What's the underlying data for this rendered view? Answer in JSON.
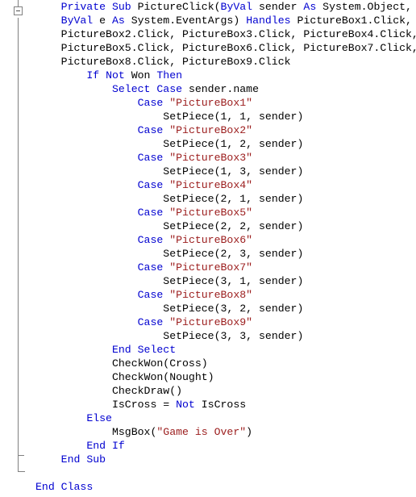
{
  "editor": {
    "language": "VB.NET",
    "colors": {
      "background": "#ffffff",
      "keyword": "#0000D0",
      "string": "#9B1C1C",
      "identifier": "#000000",
      "gutter_line": "#808080"
    },
    "gutter": {
      "fold_box_icon": "minus-icon",
      "fold_box_state": "expanded"
    }
  },
  "code": {
    "lines": [
      {
        "indent": 4,
        "continuation": true,
        "tokens": [
          {
            "t": "Private",
            "c": "kw"
          },
          {
            "t": " ",
            "c": "id"
          },
          {
            "t": "Sub",
            "c": "kw"
          },
          {
            "t": " PictureClick(",
            "c": "id"
          },
          {
            "t": "ByVal",
            "c": "kw"
          },
          {
            "t": " sender ",
            "c": "id"
          },
          {
            "t": "As",
            "c": "kw"
          },
          {
            "t": " System.Object, ",
            "c": "id"
          }
        ]
      },
      {
        "indent": 4,
        "continuation": true,
        "tokens": [
          {
            "t": "ByVal",
            "c": "kw"
          },
          {
            "t": " e ",
            "c": "id"
          },
          {
            "t": "As",
            "c": "kw"
          },
          {
            "t": " System.EventArgs) ",
            "c": "id"
          },
          {
            "t": "Handles",
            "c": "kw"
          },
          {
            "t": " PictureBox1.Click, ",
            "c": "id"
          }
        ]
      },
      {
        "indent": 4,
        "continuation": true,
        "tokens": [
          {
            "t": "PictureBox2.Click, PictureBox3.Click, PictureBox4.Click, ",
            "c": "id"
          }
        ]
      },
      {
        "indent": 4,
        "continuation": true,
        "tokens": [
          {
            "t": "PictureBox5.Click, PictureBox6.Click, PictureBox7.Click, ",
            "c": "id"
          }
        ]
      },
      {
        "indent": 4,
        "continuation": false,
        "tokens": [
          {
            "t": "PictureBox8.Click, PictureBox9.Click",
            "c": "id"
          }
        ]
      },
      {
        "indent": 8,
        "continuation": false,
        "tokens": [
          {
            "t": "If",
            "c": "kw"
          },
          {
            "t": " ",
            "c": "id"
          },
          {
            "t": "Not",
            "c": "kw"
          },
          {
            "t": " Won ",
            "c": "id"
          },
          {
            "t": "Then",
            "c": "kw"
          }
        ]
      },
      {
        "indent": 12,
        "continuation": false,
        "tokens": [
          {
            "t": "Select",
            "c": "kw"
          },
          {
            "t": " ",
            "c": "id"
          },
          {
            "t": "Case",
            "c": "kw"
          },
          {
            "t": " sender.name",
            "c": "id"
          }
        ]
      },
      {
        "indent": 16,
        "continuation": false,
        "tokens": [
          {
            "t": "Case",
            "c": "kw"
          },
          {
            "t": " ",
            "c": "id"
          },
          {
            "t": "\"PictureBox1\"",
            "c": "str"
          }
        ]
      },
      {
        "indent": 20,
        "continuation": false,
        "tokens": [
          {
            "t": "SetPiece(1, 1, sender)",
            "c": "id"
          }
        ]
      },
      {
        "indent": 16,
        "continuation": false,
        "tokens": [
          {
            "t": "Case",
            "c": "kw"
          },
          {
            "t": " ",
            "c": "id"
          },
          {
            "t": "\"PictureBox2\"",
            "c": "str"
          }
        ]
      },
      {
        "indent": 20,
        "continuation": false,
        "tokens": [
          {
            "t": "SetPiece(1, 2, sender)",
            "c": "id"
          }
        ]
      },
      {
        "indent": 16,
        "continuation": false,
        "tokens": [
          {
            "t": "Case",
            "c": "kw"
          },
          {
            "t": " ",
            "c": "id"
          },
          {
            "t": "\"PictureBox3\"",
            "c": "str"
          }
        ]
      },
      {
        "indent": 20,
        "continuation": false,
        "tokens": [
          {
            "t": "SetPiece(1, 3, sender)",
            "c": "id"
          }
        ]
      },
      {
        "indent": 16,
        "continuation": false,
        "tokens": [
          {
            "t": "Case",
            "c": "kw"
          },
          {
            "t": " ",
            "c": "id"
          },
          {
            "t": "\"PictureBox4\"",
            "c": "str"
          }
        ]
      },
      {
        "indent": 20,
        "continuation": false,
        "tokens": [
          {
            "t": "SetPiece(2, 1, sender)",
            "c": "id"
          }
        ]
      },
      {
        "indent": 16,
        "continuation": false,
        "tokens": [
          {
            "t": "Case",
            "c": "kw"
          },
          {
            "t": " ",
            "c": "id"
          },
          {
            "t": "\"PictureBox5\"",
            "c": "str"
          }
        ]
      },
      {
        "indent": 20,
        "continuation": false,
        "tokens": [
          {
            "t": "SetPiece(2, 2, sender)",
            "c": "id"
          }
        ]
      },
      {
        "indent": 16,
        "continuation": false,
        "tokens": [
          {
            "t": "Case",
            "c": "kw"
          },
          {
            "t": " ",
            "c": "id"
          },
          {
            "t": "\"PictureBox6\"",
            "c": "str"
          }
        ]
      },
      {
        "indent": 20,
        "continuation": false,
        "tokens": [
          {
            "t": "SetPiece(2, 3, sender)",
            "c": "id"
          }
        ]
      },
      {
        "indent": 16,
        "continuation": false,
        "tokens": [
          {
            "t": "Case",
            "c": "kw"
          },
          {
            "t": " ",
            "c": "id"
          },
          {
            "t": "\"PictureBox7\"",
            "c": "str"
          }
        ]
      },
      {
        "indent": 20,
        "continuation": false,
        "tokens": [
          {
            "t": "SetPiece(3, 1, sender)",
            "c": "id"
          }
        ]
      },
      {
        "indent": 16,
        "continuation": false,
        "tokens": [
          {
            "t": "Case",
            "c": "kw"
          },
          {
            "t": " ",
            "c": "id"
          },
          {
            "t": "\"PictureBox8\"",
            "c": "str"
          }
        ]
      },
      {
        "indent": 20,
        "continuation": false,
        "tokens": [
          {
            "t": "SetPiece(3, 2, sender)",
            "c": "id"
          }
        ]
      },
      {
        "indent": 16,
        "continuation": false,
        "tokens": [
          {
            "t": "Case",
            "c": "kw"
          },
          {
            "t": " ",
            "c": "id"
          },
          {
            "t": "\"PictureBox9\"",
            "c": "str"
          }
        ]
      },
      {
        "indent": 20,
        "continuation": false,
        "tokens": [
          {
            "t": "SetPiece(3, 3, sender)",
            "c": "id"
          }
        ]
      },
      {
        "indent": 12,
        "continuation": false,
        "tokens": [
          {
            "t": "End",
            "c": "kw"
          },
          {
            "t": " ",
            "c": "id"
          },
          {
            "t": "Select",
            "c": "kw"
          }
        ]
      },
      {
        "indent": 12,
        "continuation": false,
        "tokens": [
          {
            "t": "CheckWon(Cross)",
            "c": "id"
          }
        ]
      },
      {
        "indent": 12,
        "continuation": false,
        "tokens": [
          {
            "t": "CheckWon(Nought)",
            "c": "id"
          }
        ]
      },
      {
        "indent": 12,
        "continuation": false,
        "tokens": [
          {
            "t": "CheckDraw()",
            "c": "id"
          }
        ]
      },
      {
        "indent": 12,
        "continuation": false,
        "tokens": [
          {
            "t": "IsCross = ",
            "c": "id"
          },
          {
            "t": "Not",
            "c": "kw"
          },
          {
            "t": " IsCross",
            "c": "id"
          }
        ]
      },
      {
        "indent": 8,
        "continuation": false,
        "tokens": [
          {
            "t": "Else",
            "c": "kw"
          }
        ]
      },
      {
        "indent": 12,
        "continuation": false,
        "tokens": [
          {
            "t": "MsgBox(",
            "c": "id"
          },
          {
            "t": "\"Game is Over\"",
            "c": "str"
          },
          {
            "t": ")",
            "c": "id"
          }
        ]
      },
      {
        "indent": 8,
        "continuation": false,
        "tokens": [
          {
            "t": "End",
            "c": "kw"
          },
          {
            "t": " ",
            "c": "id"
          },
          {
            "t": "If",
            "c": "kw"
          }
        ]
      },
      {
        "indent": 4,
        "continuation": false,
        "tokens": [
          {
            "t": "End",
            "c": "kw"
          },
          {
            "t": " ",
            "c": "id"
          },
          {
            "t": "Sub",
            "c": "kw"
          }
        ]
      },
      {
        "indent": 0,
        "continuation": false,
        "tokens": []
      },
      {
        "indent": 0,
        "continuation": false,
        "tokens": [
          {
            "t": "End",
            "c": "kw"
          },
          {
            "t": " ",
            "c": "id"
          },
          {
            "t": "Class",
            "c": "kw"
          }
        ]
      }
    ],
    "continuation_char": "_"
  }
}
